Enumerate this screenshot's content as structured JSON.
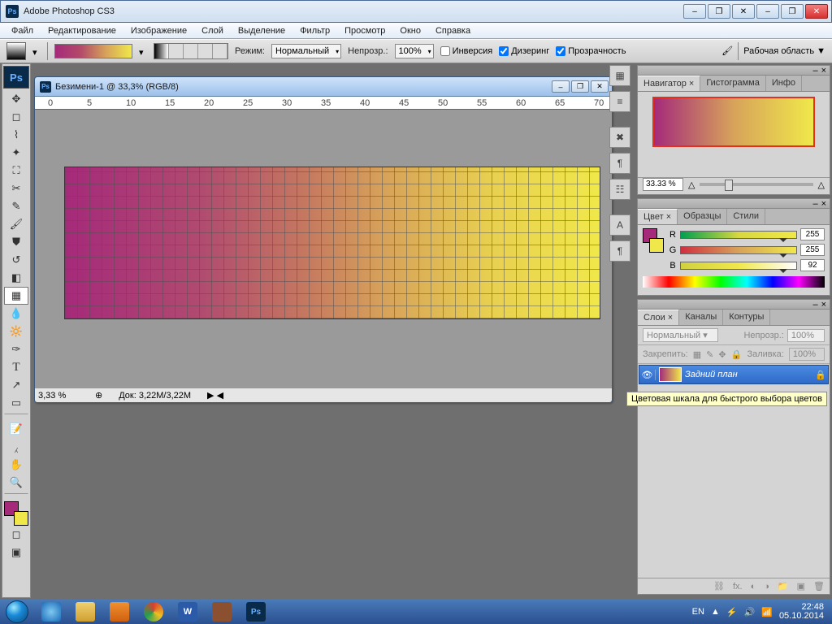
{
  "titlebar": {
    "app_name": "Adobe Photoshop CS3"
  },
  "menu": [
    "Файл",
    "Редактирование",
    "Изображение",
    "Слой",
    "Выделение",
    "Фильтр",
    "Просмотр",
    "Окно",
    "Справка"
  ],
  "options": {
    "mode_label": "Режим:",
    "mode_value": "Нормальный",
    "opacity_label": "Непрозр.:",
    "opacity_value": "100%",
    "reverse": "Инверсия",
    "dither": "Дизеринг",
    "transparency": "Прозрачность",
    "workspace": "Рабочая область ▼"
  },
  "document": {
    "title": "Безимени-1 @ 33,3% (RGB/8)",
    "zoom": "3,33 %",
    "docsize": "Док: 3,22M/3,22M",
    "ruler_marks": [
      "0",
      "5",
      "10",
      "15",
      "20",
      "25",
      "30",
      "35",
      "40",
      "45",
      "50",
      "55",
      "60",
      "65",
      "70"
    ]
  },
  "navigator": {
    "tabs": [
      "Навигатор ×",
      "Гистограмма",
      "Инфо"
    ],
    "zoom": "33.33 %"
  },
  "color": {
    "tabs": [
      "Цвет ×",
      "Образцы",
      "Стили"
    ],
    "r_label": "R",
    "g_label": "G",
    "b_label": "B",
    "r": "255",
    "g": "255",
    "b": "92"
  },
  "layers": {
    "tabs": [
      "Слои ×",
      "Каналы",
      "Контуры"
    ],
    "blend": "Нормальный",
    "opacity_label": "Непрозр.:",
    "opacity": "100%",
    "lock_label": "Закрепить:",
    "fill_label": "Заливка:",
    "fill": "100%",
    "layer_name": "Задний план"
  },
  "tooltip": "Цветовая шкала для быстрого выбора цветов",
  "tray": {
    "lang": "EN",
    "time": "22:48",
    "date": "05.10.2014"
  }
}
